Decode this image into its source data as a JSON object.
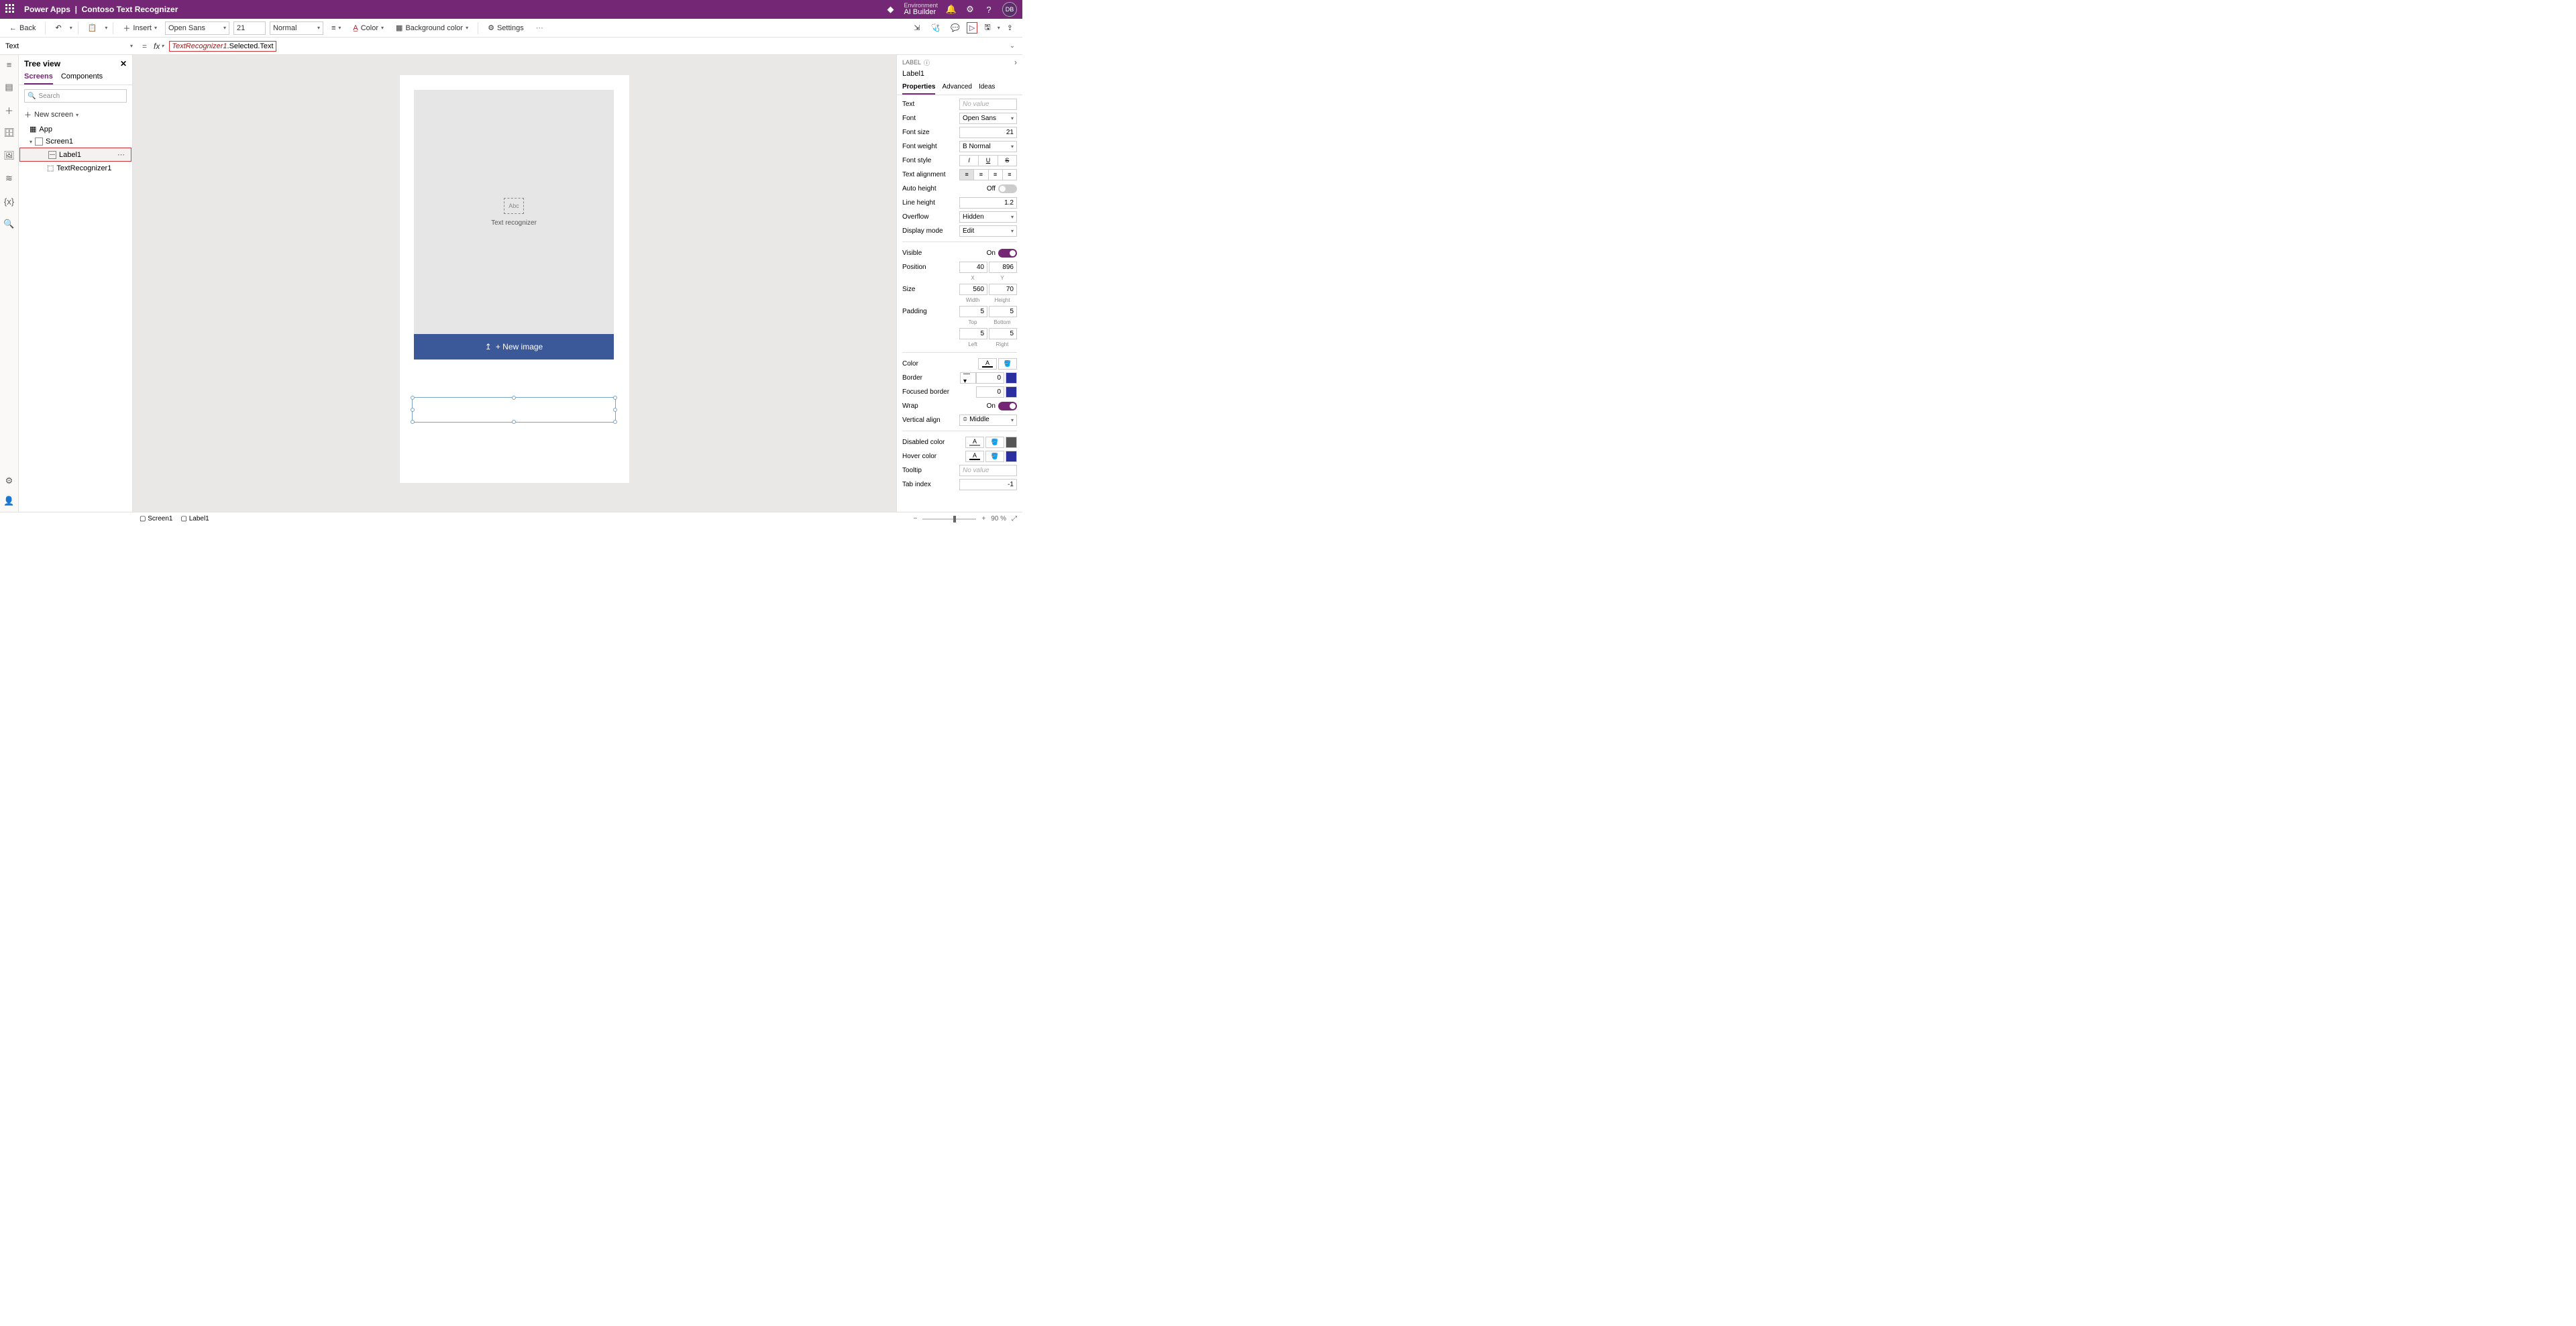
{
  "header": {
    "appName": "Power Apps",
    "fileName": "Contoso Text Recognizer",
    "envLabel": "Environment",
    "envName": "AI Builder",
    "avatar": "DB"
  },
  "toolbar": {
    "back": "Back",
    "insert": "Insert",
    "font": "Open Sans",
    "fontSize": "21",
    "fontWeight": "Normal",
    "color": "Color",
    "bgColor": "Background color",
    "settings": "Settings"
  },
  "formula": {
    "property": "Text",
    "expressionStyled": "TextRecognizer1",
    "expressionRest": ".Selected.Text"
  },
  "tree": {
    "title": "Tree view",
    "tabs": [
      "Screens",
      "Components"
    ],
    "searchPlaceholder": "Search",
    "newScreen": "New screen",
    "app": "App",
    "screen": "Screen1",
    "label": "Label1",
    "recognizer": "TextRecognizer1"
  },
  "canvas": {
    "recLabel": "Text recognizer",
    "recIconText": "Abc",
    "newImage": "+ New image"
  },
  "rightPanel": {
    "category": "LABEL",
    "name": "Label1",
    "tabs": [
      "Properties",
      "Advanced",
      "Ideas"
    ],
    "text": {
      "lbl": "Text",
      "val": "No value"
    },
    "font": {
      "lbl": "Font",
      "val": "Open Sans"
    },
    "fontSize": {
      "lbl": "Font size",
      "val": "21"
    },
    "fontWeight": {
      "lbl": "Font weight",
      "val": "B Normal"
    },
    "fontStyle": {
      "lbl": "Font style"
    },
    "align": {
      "lbl": "Text alignment"
    },
    "autoHeight": {
      "lbl": "Auto height",
      "state": "Off"
    },
    "lineHeight": {
      "lbl": "Line height",
      "val": "1.2"
    },
    "overflow": {
      "lbl": "Overflow",
      "val": "Hidden"
    },
    "displayMode": {
      "lbl": "Display mode",
      "val": "Edit"
    },
    "visible": {
      "lbl": "Visible",
      "state": "On"
    },
    "position": {
      "lbl": "Position",
      "x": "40",
      "y": "896",
      "xlbl": "X",
      "ylbl": "Y"
    },
    "size": {
      "lbl": "Size",
      "w": "560",
      "h": "70",
      "wlbl": "Width",
      "hlbl": "Height"
    },
    "padding": {
      "lbl": "Padding",
      "t": "5",
      "b": "5",
      "l": "5",
      "r": "5",
      "tlbl": "Top",
      "blbl": "Bottom",
      "llbl": "Left",
      "rlbl": "Right"
    },
    "color": {
      "lbl": "Color"
    },
    "border": {
      "lbl": "Border",
      "val": "0"
    },
    "focusedBorder": {
      "lbl": "Focused border",
      "val": "0"
    },
    "wrap": {
      "lbl": "Wrap",
      "state": "On"
    },
    "valign": {
      "lbl": "Vertical align",
      "val": "Middle"
    },
    "disabledColor": {
      "lbl": "Disabled color"
    },
    "hoverColor": {
      "lbl": "Hover color"
    },
    "tooltip": {
      "lbl": "Tooltip",
      "val": "No value"
    },
    "tabIndex": {
      "lbl": "Tab index",
      "val": "-1"
    }
  },
  "status": {
    "screen": "Screen1",
    "label": "Label1",
    "zoom": "90",
    "pct": "%"
  }
}
